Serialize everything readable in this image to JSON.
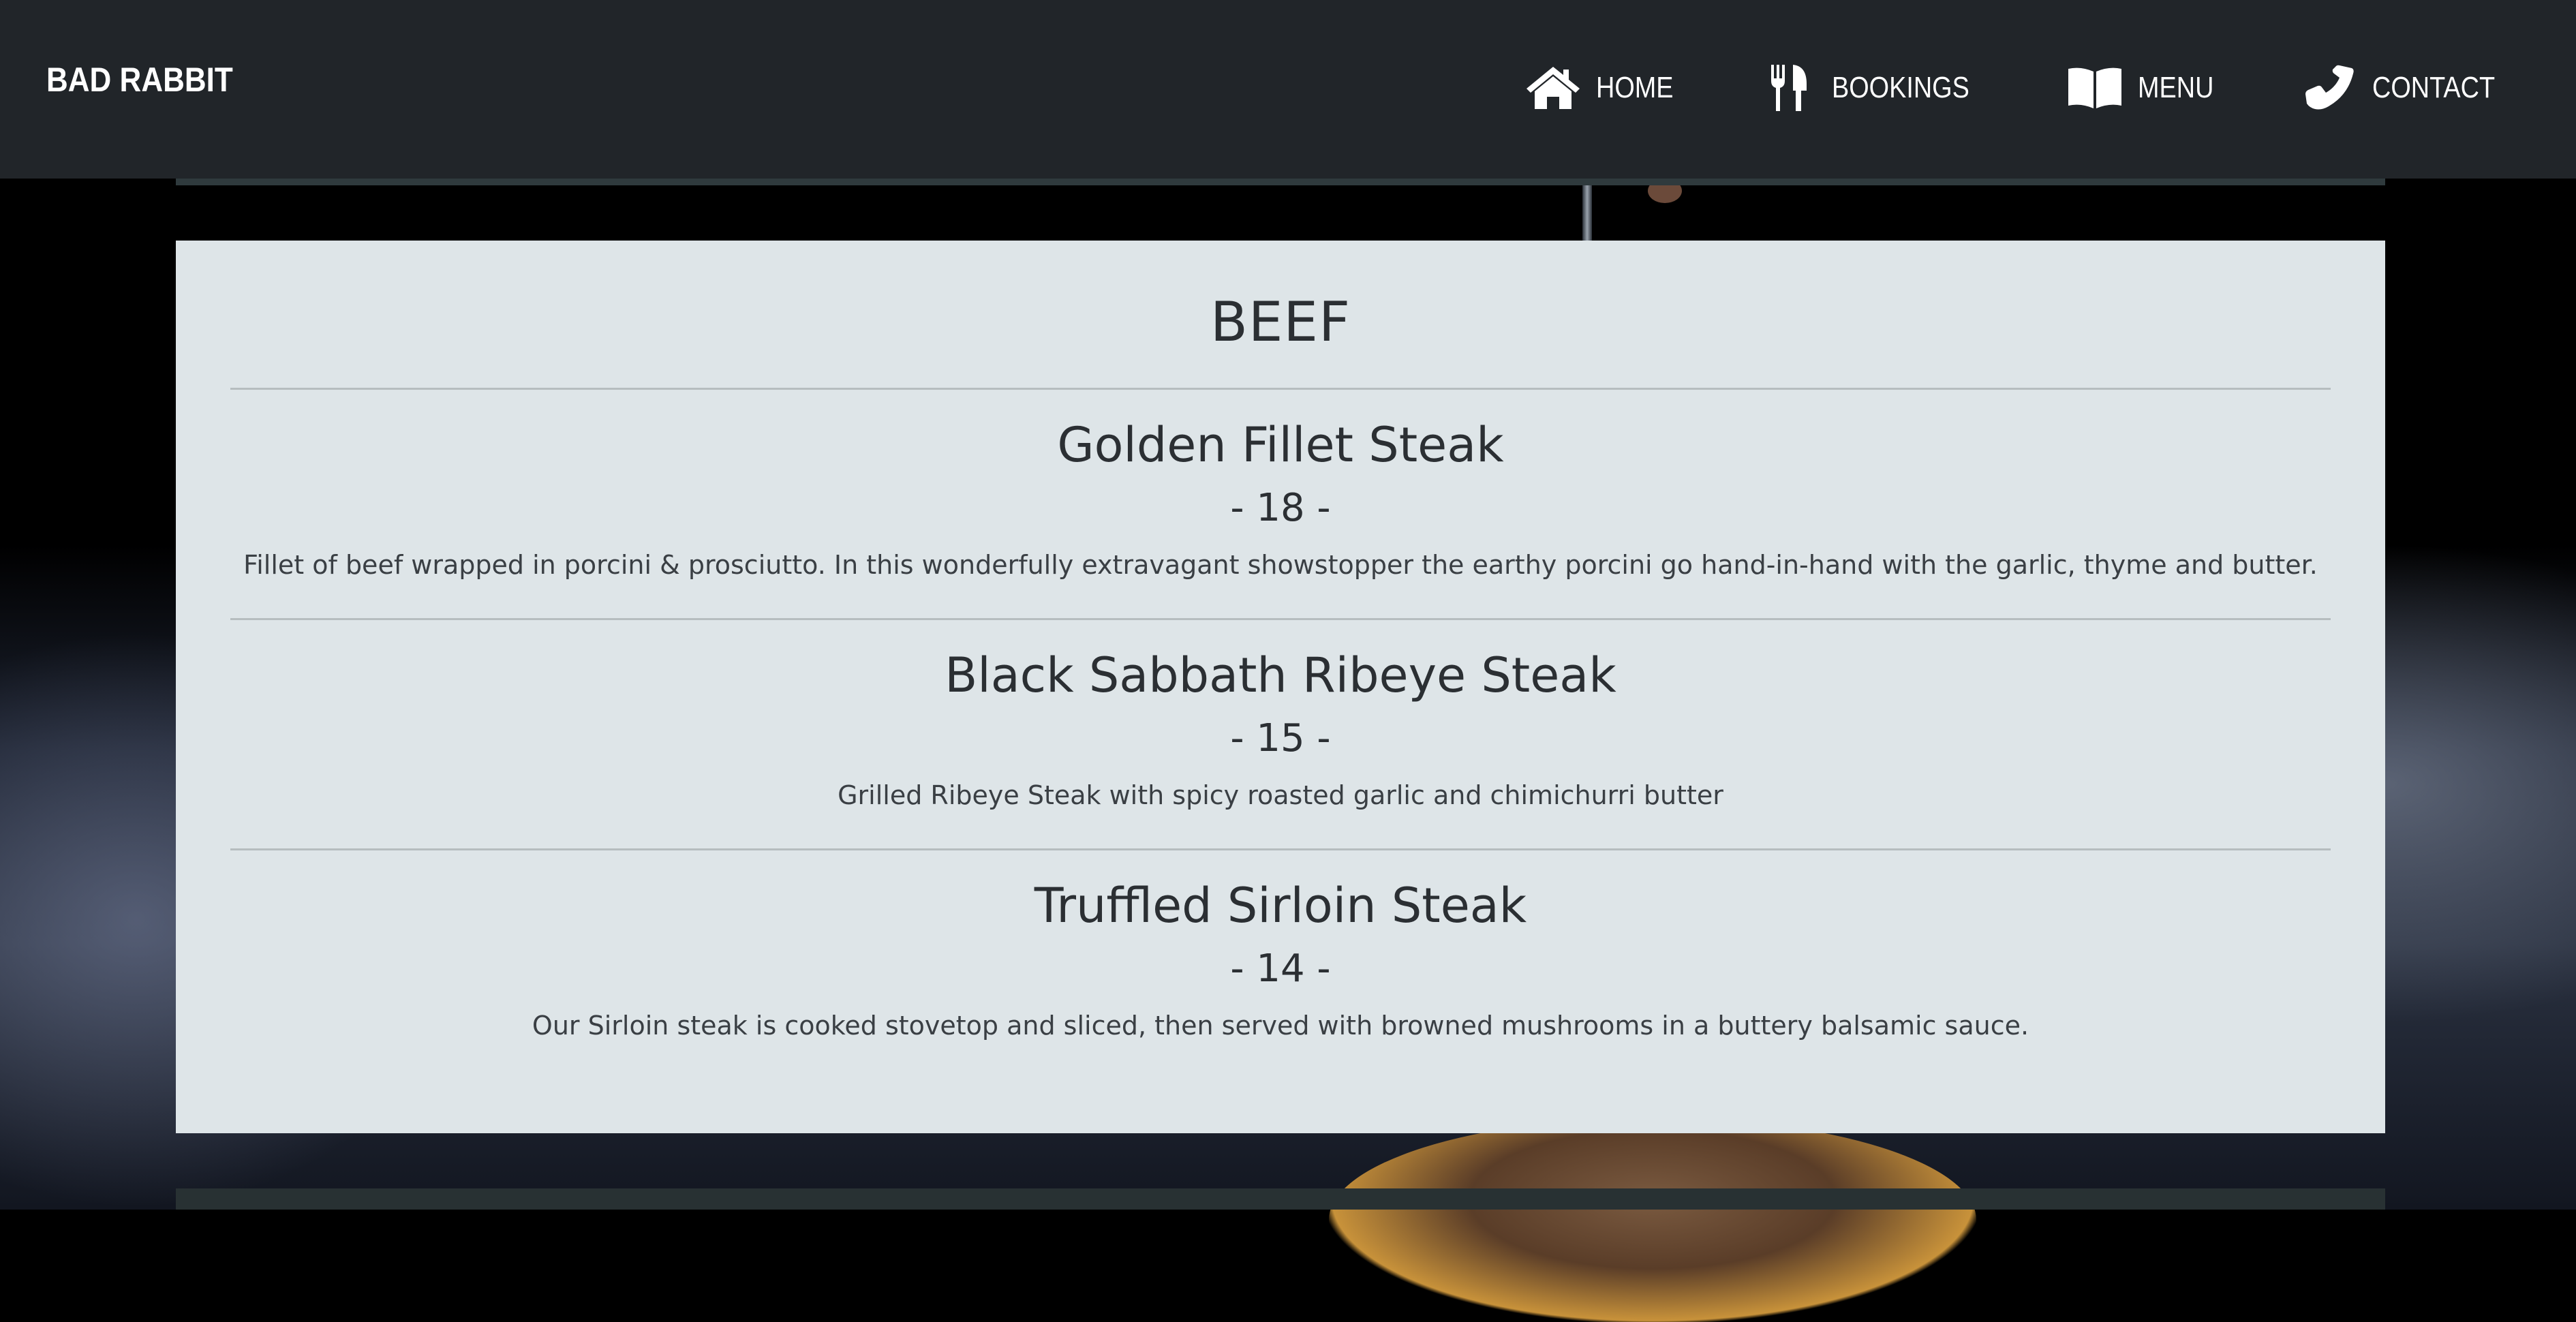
{
  "header": {
    "brand": "BAD RABBIT",
    "nav": [
      {
        "label": "HOME",
        "icon": "home-icon"
      },
      {
        "label": "BOOKINGS",
        "icon": "utensils-icon"
      },
      {
        "label": "MENU",
        "icon": "book-icon"
      },
      {
        "label": "CONTACT",
        "icon": "phone-icon"
      }
    ]
  },
  "menu_section": {
    "title": "BEEF",
    "items": [
      {
        "name": "Golden Fillet Steak",
        "price": "- 18 -",
        "description": "Fillet of beef wrapped in porcini & prosciutto. In this wonderfully extravagant showstopper the earthy porcini go hand-in-hand with the garlic, thyme and butter."
      },
      {
        "name": "Black Sabbath Ribeye Steak",
        "price": "- 15 -",
        "description": "Grilled Ribeye Steak with spicy roasted garlic and chimichurri butter"
      },
      {
        "name": "Truffled Sirloin Steak",
        "price": "- 14 -",
        "description": "Our Sirloin steak is cooked stovetop and sliced, then served with browned mushrooms in a buttery balsamic sauce."
      }
    ]
  },
  "colors": {
    "navbar_bg": "#212529",
    "card_bg": "#dee5e8",
    "text": "#2b2f33",
    "nav_text": "#ffffff"
  }
}
